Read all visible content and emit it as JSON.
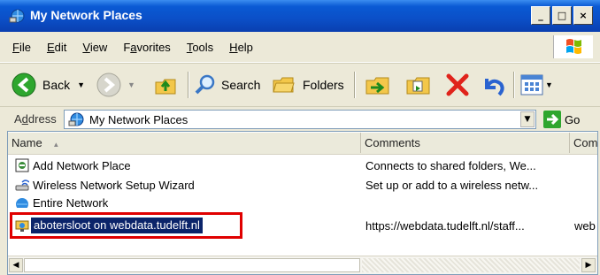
{
  "window": {
    "title": "My Network Places"
  },
  "caption_buttons": {
    "minimize": "_",
    "maximize": "□",
    "close": "×"
  },
  "menu": [
    {
      "label": "File",
      "key": "F",
      "rest": "ile"
    },
    {
      "label": "Edit",
      "key": "E",
      "rest": "dit"
    },
    {
      "label": "View",
      "key": "V",
      "rest": "iew"
    },
    {
      "label": "Favorites",
      "pre": "F",
      "key": "a",
      "rest": "vorites"
    },
    {
      "label": "Tools",
      "key": "T",
      "rest": "ools"
    },
    {
      "label": "Help",
      "key": "H",
      "rest": "elp"
    }
  ],
  "toolbar": {
    "back_label": "Back",
    "search_label": "Search",
    "folders_label": "Folders"
  },
  "address": {
    "label_pre": "A",
    "label_key": "d",
    "label_rest": "dress",
    "value": "My Network Places",
    "go_label": "Go"
  },
  "list": {
    "columns": [
      "Name",
      "Comments",
      "Com"
    ],
    "rows": [
      {
        "name": "Add Network Place",
        "comments": "Connects to shared folders, We...",
        "extra": ""
      },
      {
        "name": "Wireless Network Setup Wizard",
        "comments": "Set up or add to a wireless netw...",
        "extra": ""
      },
      {
        "name": "Entire Network",
        "comments": "",
        "extra": ""
      },
      {
        "name": "abotersloot on webdata.tudelft.nl",
        "comments": "https://webdata.tudelft.nl/staff...",
        "extra": "web"
      }
    ]
  },
  "colors": {
    "title_blue": "#0b4fc7",
    "selection": "#0b246a",
    "highlight_box": "#e00000"
  }
}
